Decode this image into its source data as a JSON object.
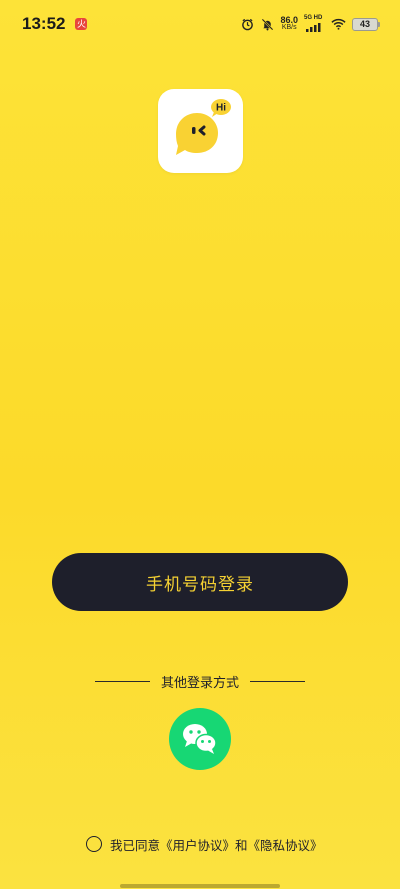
{
  "status_bar": {
    "time": "13:52",
    "notification_badge": "火",
    "net_speed_value": "86.0",
    "net_speed_unit": "KB/s",
    "signal_label": "5G HD",
    "battery_level": "43"
  },
  "logo": {
    "bubble_text": "Hi",
    "bubble_color": "#F9D233",
    "eye_color": "#1E1F2B"
  },
  "login": {
    "phone_login_label": "手机号码登录",
    "other_methods_label": "其他登录方式"
  },
  "agreement": {
    "prefix": "我已同意",
    "user_agreement": "《用户协议》",
    "conjunction": "和",
    "privacy_policy": "《隐私协议》"
  },
  "colors": {
    "background": "#FCDA2A",
    "button_dark": "#1E1F2B",
    "button_text": "#F5D133",
    "wechat_green": "#17D774"
  }
}
